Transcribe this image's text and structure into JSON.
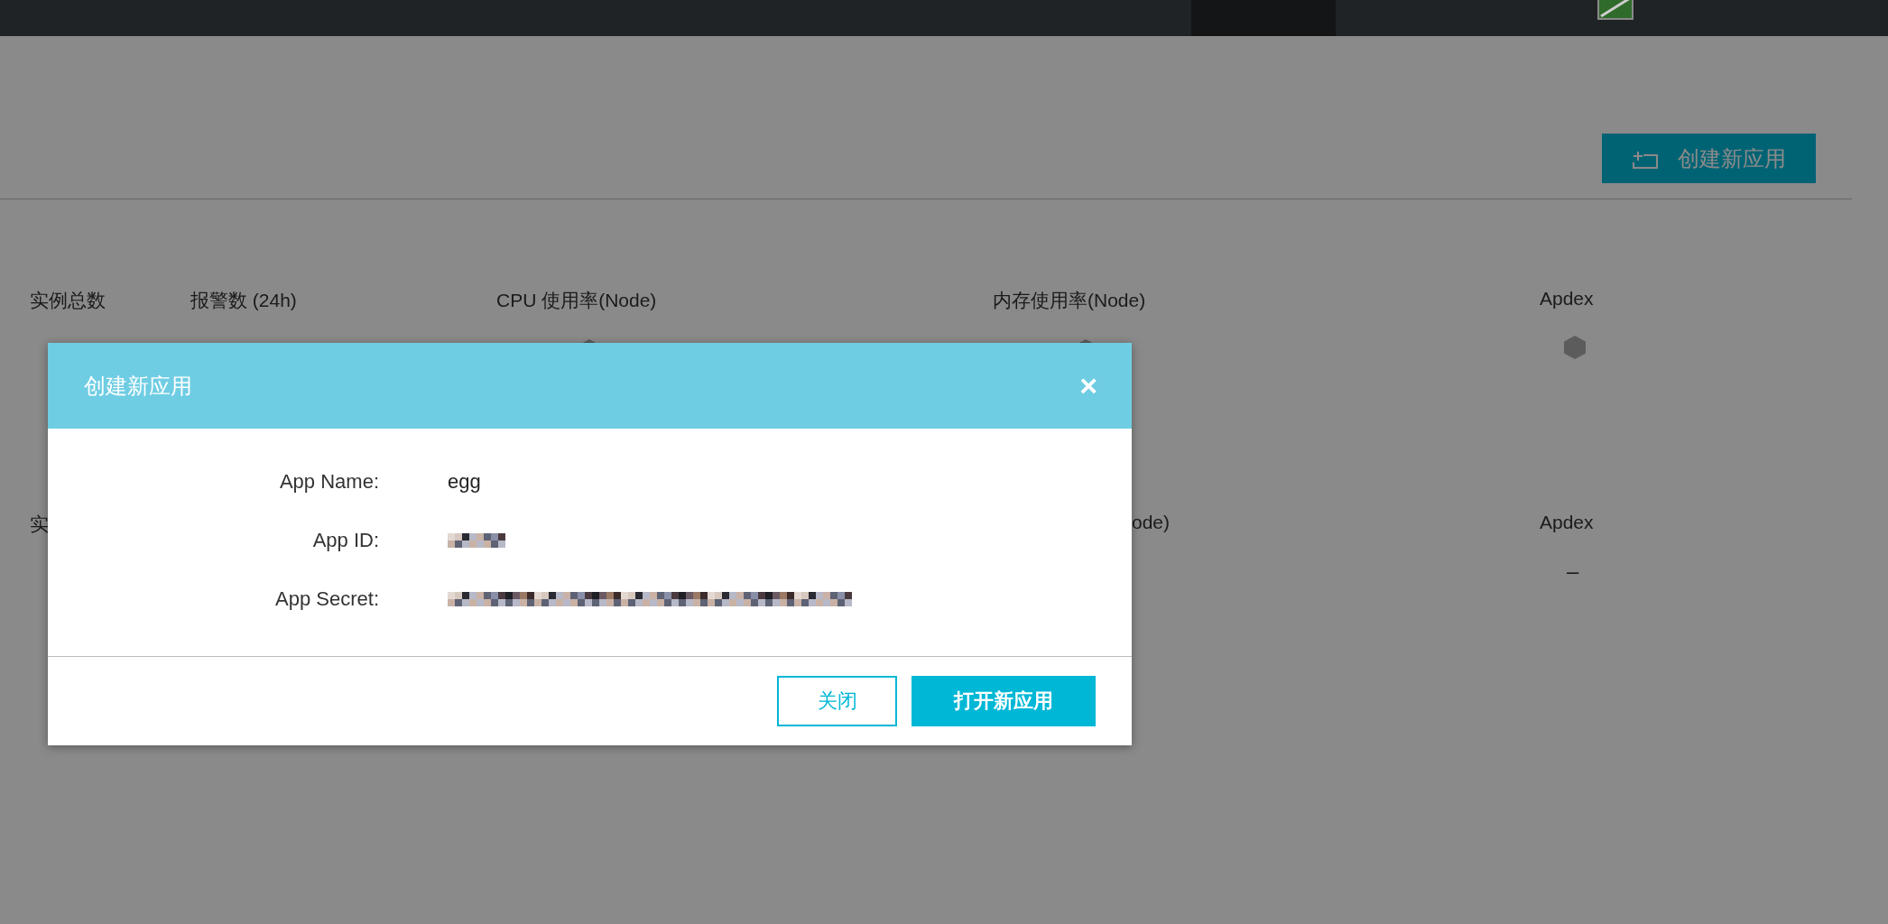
{
  "create_button": {
    "label": "创建新应用"
  },
  "stats_row_1": [
    {
      "label": "实例总数",
      "kind": "plain"
    },
    {
      "label": "报警数 (24h)",
      "kind": "plain"
    },
    {
      "label": "CPU 使用率(Node)",
      "kind": "hexagon"
    },
    {
      "label": "内存使用率(Node)",
      "kind": "hexagon"
    },
    {
      "label": "Apdex",
      "kind": "hexagon"
    }
  ],
  "stats_row_2": [
    {
      "label": "实",
      "kind": "partial"
    },
    {
      "label": "ode)",
      "kind": "partial"
    },
    {
      "label": "Apdex",
      "kind": "value",
      "value": "–"
    }
  ],
  "dialog": {
    "title": "创建新应用",
    "close": "×",
    "fields": [
      {
        "label": "App Name:",
        "value": "egg",
        "kind": "text"
      },
      {
        "label": "App ID:",
        "kind": "mosaic"
      },
      {
        "label": "App Secret:",
        "kind": "mosaic"
      }
    ],
    "buttons": [
      {
        "label": "关闭",
        "kind": "outline"
      },
      {
        "label": "打开新应用",
        "kind": "primary"
      }
    ]
  }
}
